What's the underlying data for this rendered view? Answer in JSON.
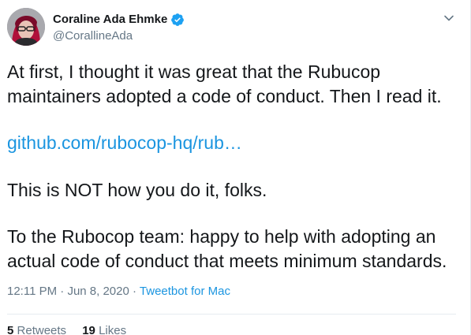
{
  "author": {
    "name": "Coraline Ada Ehmke",
    "handle": "@CorallineAda",
    "avatar": "avatar-photo",
    "verified": true
  },
  "icons": {
    "verified": "verified-badge-icon",
    "menu": "chevron-down-icon"
  },
  "colors": {
    "link": "#1b95e0",
    "muted": "#657786",
    "text": "#14171a",
    "verified": "#1da1f2"
  },
  "tweet": {
    "paragraph1": "At first, I thought it was great that the Rubucop maintainers adopted a code of conduct. Then I read it.",
    "link": "github.com/rubocop-hq/rub…",
    "paragraph2": "This is NOT how you do it, folks.",
    "paragraph3": "To the Rubocop team: happy to help with adopting an actual code of conduct that meets minimum standards."
  },
  "meta": {
    "time": "12:11 PM",
    "separator1": " · ",
    "date": "Jun 8, 2020",
    "separator2": " · ",
    "source": "Tweetbot for Mac"
  },
  "stats": {
    "retweets_count": "5",
    "retweets_label": "Retweets",
    "likes_count": "19",
    "likes_label": "Likes"
  }
}
